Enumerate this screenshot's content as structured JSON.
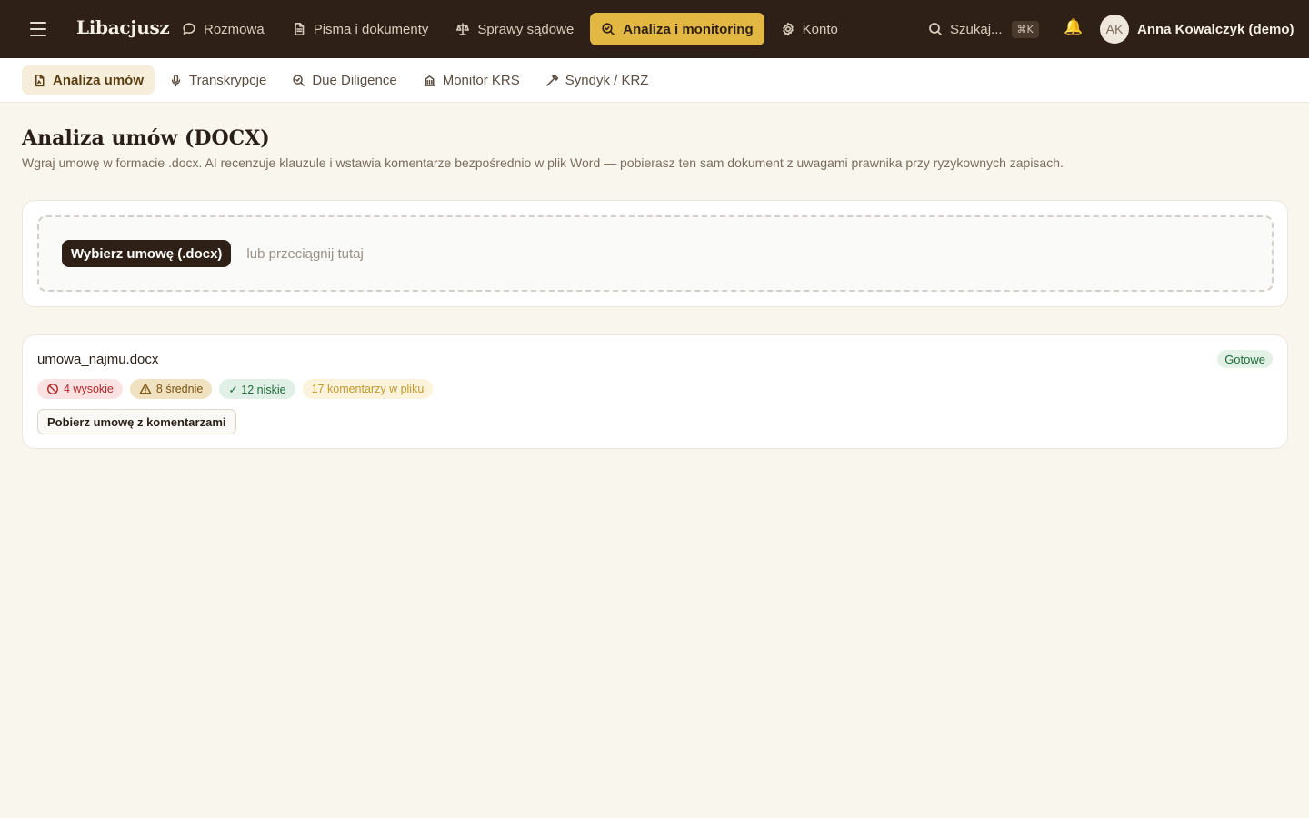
{
  "app": {
    "logo": "Libacjusz"
  },
  "nav": {
    "items": [
      {
        "label": "Rozmowa",
        "icon": "chat-bubble-icon"
      },
      {
        "label": "Pisma i dokumenty",
        "icon": "document-icon"
      },
      {
        "label": "Sprawy sądowe",
        "icon": "scales-icon"
      },
      {
        "label": "Analiza i monitoring",
        "icon": "magnifier-icon",
        "active": true
      },
      {
        "label": "Konto",
        "icon": "gear-icon"
      }
    ],
    "search_label": "Szukaj...",
    "search_shortcut": "⌘K",
    "user_initials": "AK",
    "user_name": "Anna Kowalczyk (demo)"
  },
  "subnav": {
    "items": [
      {
        "label": "Analiza umów",
        "icon": "contract-icon",
        "active": true
      },
      {
        "label": "Transkrypcje",
        "icon": "microphone-icon"
      },
      {
        "label": "Due Diligence",
        "icon": "magnifier-icon"
      },
      {
        "label": "Monitor KRS",
        "icon": "building-icon"
      },
      {
        "label": "Syndyk / KRZ",
        "icon": "gavel-icon"
      }
    ]
  },
  "page": {
    "title": "Analiza umów (DOCX)",
    "description": "Wgraj umowę w formacie .docx. AI recenzuje klauzule i wstawia komentarze bezpośrednio w plik Word — pobierasz ten sam dokument z uwagami prawnika przy ryzykownych zapisach."
  },
  "upload": {
    "button_label": "Wybierz umowę (.docx)",
    "hint": "lub przeciągnij tutaj"
  },
  "result": {
    "file_name": "umowa_najmu.docx",
    "status": "Gotowe",
    "high": "4 wysokie",
    "medium": "8 średnie",
    "low": "✓ 12 niskie",
    "comments": "17 komentarzy w pliku",
    "download_label": "Pobierz umowę z komentarzami"
  },
  "colors": {
    "topbar": "#2e2016",
    "accent": "#e2b843",
    "background": "#f9f6ee"
  }
}
